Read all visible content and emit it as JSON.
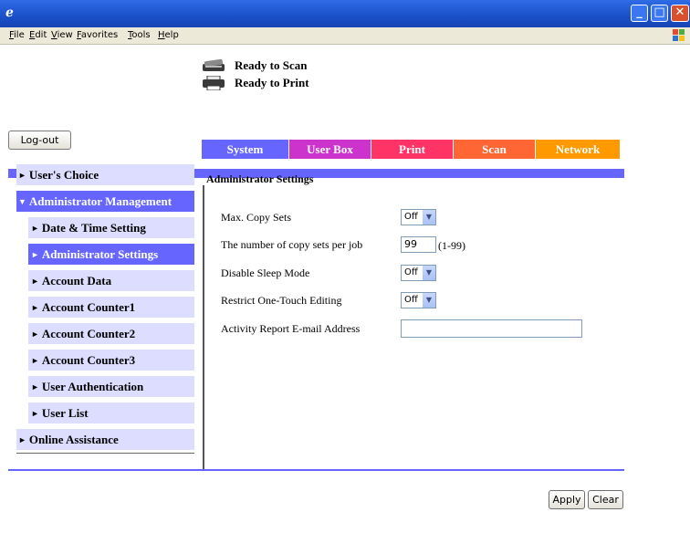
{
  "browser": {
    "menus": [
      "File",
      "Edit",
      "View",
      "Favorites",
      "Tools",
      "Help"
    ]
  },
  "status": {
    "scan": "Ready to Scan",
    "print": "Ready to Print"
  },
  "header": {
    "logout_label": "Log-out"
  },
  "tabs": [
    {
      "label": "System",
      "color": "#6666ff"
    },
    {
      "label": "User Box",
      "color": "#cc33cc"
    },
    {
      "label": "Print",
      "color": "#ff3366"
    },
    {
      "label": "Scan",
      "color": "#ff6633"
    },
    {
      "label": "Network",
      "color": "#ff9900"
    }
  ],
  "sidebar": {
    "items": [
      {
        "label": "User's Choice"
      },
      {
        "label": "Administrator Management",
        "expanded": true
      },
      {
        "label": "Date & Time Setting"
      },
      {
        "label": "Administrator Settings",
        "selected": true
      },
      {
        "label": "Account Data"
      },
      {
        "label": "Account Counter1"
      },
      {
        "label": "Account Counter2"
      },
      {
        "label": "Account Counter3"
      },
      {
        "label": "User Authentication"
      },
      {
        "label": "User List"
      },
      {
        "label": "Online Assistance"
      }
    ]
  },
  "main": {
    "title": "Administrator Settings",
    "fields": {
      "max_copy_sets": {
        "label": "Max. Copy Sets",
        "value": "Off"
      },
      "copy_sets_per_job": {
        "label": "The number of copy sets per job",
        "value": "99",
        "hint": "(1-99)"
      },
      "disable_sleep": {
        "label": "Disable Sleep Mode",
        "value": "Off"
      },
      "restrict_one_touch": {
        "label": "Restrict One-Touch Editing",
        "value": "Off"
      },
      "activity_email": {
        "label": "Activity Report E-mail Address",
        "value": ""
      }
    }
  },
  "actions": {
    "apply": "Apply",
    "clear": "Clear"
  },
  "colors": {
    "accent_band": "#6666ff",
    "sidebar_bg": "#ddddff",
    "sidebar_selected_bg": "#6666ff"
  }
}
